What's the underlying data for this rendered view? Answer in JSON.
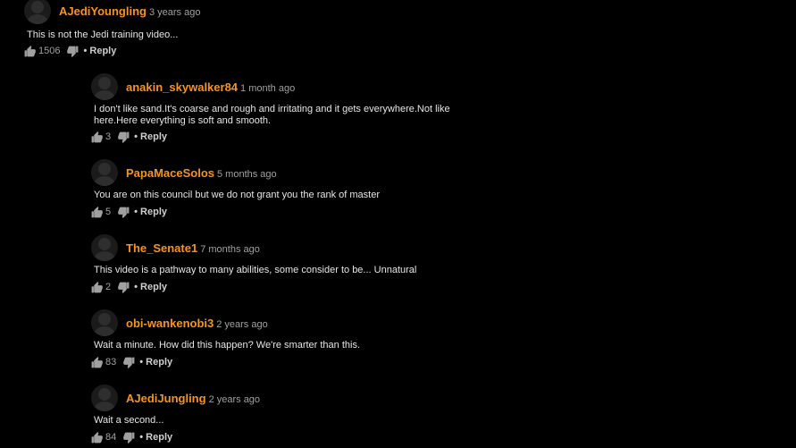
{
  "comments": [
    {
      "username": "AJediYoungling",
      "time": "3 years ago",
      "text": "This is not the Jedi training video...",
      "likes": "1506",
      "reply": "• Reply",
      "reply_indent": false
    },
    {
      "username": "anakin_skywalker84",
      "time": "1 month ago",
      "text": "I don't like sand.It's coarse and rough and irritating and it gets everywhere.Not like here.Here everything is soft and smooth.",
      "likes": "3",
      "reply": "• Reply",
      "reply_indent": true
    },
    {
      "username": "PapaMaceSolos",
      "time": "5 months ago",
      "text": "You are on this council but we do not grant you the rank of master",
      "likes": "5",
      "reply": "• Reply",
      "reply_indent": true
    },
    {
      "username": "The_Senate1",
      "time": "7 months ago",
      "text": "This video is a pathway to many abilities, some consider to be... Unnatural",
      "likes": "2",
      "reply": "• Reply",
      "reply_indent": true
    },
    {
      "username": "obi-wankenobi3",
      "time": "2 years ago",
      "text": "Wait a minute. How did this happen? We're smarter than this.",
      "likes": "83",
      "reply": "• Reply",
      "reply_indent": true
    },
    {
      "username": "AJediJungling",
      "time": "2 years ago",
      "text": "Wait a second...",
      "likes": "84",
      "reply": "• Reply",
      "reply_indent": true
    }
  ],
  "icons": {
    "like": "thumbs-up-icon",
    "dislike": "thumbs-down-icon",
    "avatar": "user-avatar"
  },
  "colors": {
    "background": "#000000",
    "username": "#f7931e",
    "text": "#e6e6e6",
    "muted": "#a0a0a0"
  }
}
